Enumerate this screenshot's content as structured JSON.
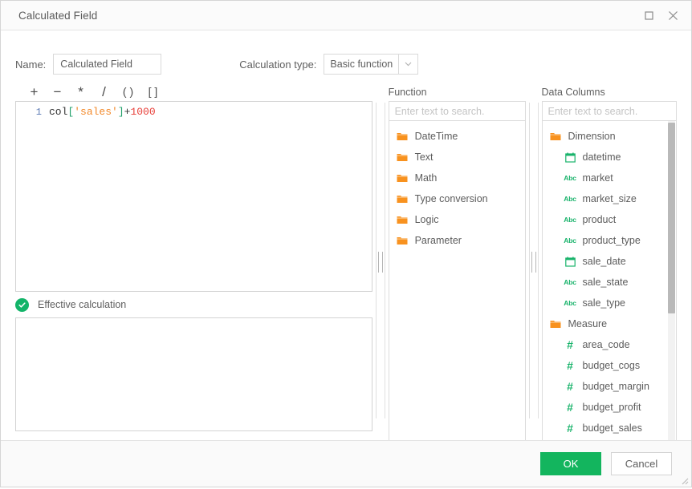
{
  "window": {
    "title": "Calculated Field",
    "maximize_icon": "maximize-icon",
    "close_icon": "close-icon"
  },
  "form": {
    "name_label": "Name:",
    "name_value": "Calculated Field",
    "calc_type_label": "Calculation type:",
    "calc_type_value": "Basic function",
    "calc_type_options": [
      "Basic function"
    ]
  },
  "toolbar": {
    "operators": [
      {
        "name": "plus",
        "glyph": "+"
      },
      {
        "name": "minus",
        "glyph": "−"
      },
      {
        "name": "multiply",
        "glyph": "*"
      },
      {
        "name": "divide",
        "glyph": "/"
      },
      {
        "name": "parentheses",
        "glyph": "( )"
      },
      {
        "name": "brackets",
        "glyph": "[ ]"
      }
    ]
  },
  "editor": {
    "line_number": "1",
    "tokens": [
      {
        "type": "id",
        "text": "col"
      },
      {
        "type": "brk",
        "text": "["
      },
      {
        "type": "str",
        "text": "'sales'"
      },
      {
        "type": "brk",
        "text": "]"
      },
      {
        "type": "op",
        "text": "+"
      },
      {
        "type": "num",
        "text": "1000"
      }
    ],
    "full_expression": "col['sales']+1000"
  },
  "effective": {
    "status_icon": "check-circle-icon",
    "label": "Effective calculation",
    "output_value": ""
  },
  "function_panel": {
    "title": "Function",
    "search_placeholder": "Enter text to search.",
    "search_value": "",
    "items": [
      {
        "label": "DateTime",
        "icon": "folder-icon"
      },
      {
        "label": "Text",
        "icon": "folder-icon"
      },
      {
        "label": "Math",
        "icon": "folder-icon"
      },
      {
        "label": "Type conversion",
        "icon": "folder-icon"
      },
      {
        "label": "Logic",
        "icon": "folder-icon"
      },
      {
        "label": "Parameter",
        "icon": "folder-icon"
      }
    ]
  },
  "data_columns_panel": {
    "title": "Data Columns",
    "search_placeholder": "Enter text to search.",
    "search_value": "",
    "items": [
      {
        "label": "Dimension",
        "icon": "folder-icon",
        "level": 1
      },
      {
        "label": "datetime",
        "icon": "calendar-icon",
        "level": 2
      },
      {
        "label": "market",
        "icon": "abc-icon",
        "level": 2
      },
      {
        "label": "market_size",
        "icon": "abc-icon",
        "level": 2
      },
      {
        "label": "product",
        "icon": "abc-icon",
        "level": 2
      },
      {
        "label": "product_type",
        "icon": "abc-icon",
        "level": 2
      },
      {
        "label": "sale_date",
        "icon": "calendar-icon",
        "level": 2
      },
      {
        "label": "sale_state",
        "icon": "abc-icon",
        "level": 2
      },
      {
        "label": "sale_type",
        "icon": "abc-icon",
        "level": 2
      },
      {
        "label": "Measure",
        "icon": "folder-icon",
        "level": 1
      },
      {
        "label": "area_code",
        "icon": "hash-icon",
        "level": 2
      },
      {
        "label": "budget_cogs",
        "icon": "hash-icon",
        "level": 2
      },
      {
        "label": "budget_margin",
        "icon": "hash-icon",
        "level": 2
      },
      {
        "label": "budget_profit",
        "icon": "hash-icon",
        "level": 2
      },
      {
        "label": "budget_sales",
        "icon": "hash-icon",
        "level": 2
      }
    ]
  },
  "footer": {
    "ok_label": "OK",
    "cancel_label": "Cancel"
  },
  "colors": {
    "accent_green": "#13b55e",
    "folder_orange": "#f8921f",
    "field_green": "#19b36b",
    "string_orange": "#f2892a",
    "number_red": "#e8403a",
    "bracket_green": "#22a06b"
  }
}
